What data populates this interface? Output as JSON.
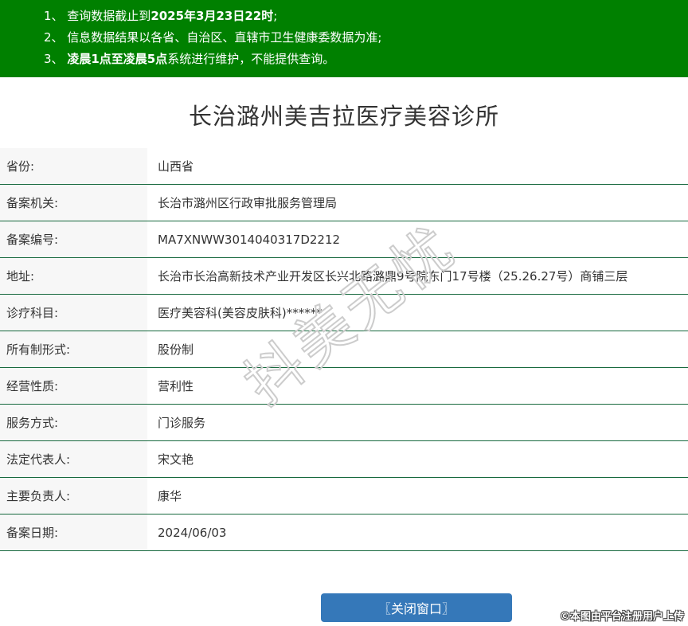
{
  "notice_banner": {
    "items": [
      {
        "prefix": "1、 查询数据截止到",
        "bold": "2025年3月23日22时",
        "suffix": ";"
      },
      {
        "prefix": "2、 信息数据结果以各省、自治区、直辖市卫生健康委数据为准;",
        "bold": "",
        "suffix": ""
      },
      {
        "prefix": "3、 ",
        "bold": "凌晨1点至凌晨5点",
        "suffix": "系统进行维护，不能提供查询。"
      }
    ]
  },
  "page_title": "长治潞州美吉拉医疗美容诊所",
  "record_table": {
    "rows": [
      {
        "label": "省份:",
        "value": "山西省"
      },
      {
        "label": "备案机关:",
        "value": "长治市潞州区行政审批服务管理局"
      },
      {
        "label": "备案编号:",
        "value": "MA7XNWW3014040317D2212"
      },
      {
        "label": "地址:",
        "value": "长治市长治高新技术产业开发区长兴北路潞鼎9号院东门17号楼（25.26.27号）商铺三层"
      },
      {
        "label": "诊疗科目:",
        "value": "医疗美容科(美容皮肤科)******"
      },
      {
        "label": "所有制形式:",
        "value": "股份制"
      },
      {
        "label": "经营性质:",
        "value": "营利性"
      },
      {
        "label": "服务方式:",
        "value": "门诊服务"
      },
      {
        "label": "法定代表人:",
        "value": "宋文艳"
      },
      {
        "label": "主要负责人:",
        "value": "康华"
      },
      {
        "label": "备案日期:",
        "value": "2024/06/03"
      }
    ]
  },
  "watermark": {
    "diagonal_text": "抖美无忧",
    "photo_credit": "©本图由平台注册用户上传"
  },
  "footer": {
    "close_button_label": "〖关闭窗口〗"
  },
  "colors": {
    "banner_green": "#008000",
    "divider_green": "#17693e",
    "button_blue": "#3578b9",
    "label_bg": "#f7f7f7",
    "text": "#333333"
  }
}
